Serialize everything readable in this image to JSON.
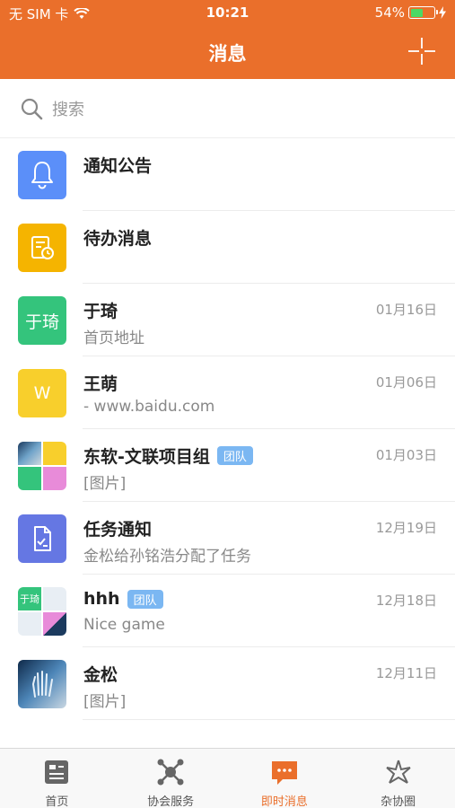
{
  "status": {
    "carrier": "无 SIM 卡",
    "time": "10:21",
    "battery": "54%",
    "battery_level": 0.54
  },
  "header": {
    "title": "消息"
  },
  "search": {
    "placeholder": "搜索"
  },
  "messages": [
    {
      "name": "通知公告",
      "preview": "",
      "date": "",
      "tag": ""
    },
    {
      "name": "待办消息",
      "preview": "",
      "date": "",
      "tag": ""
    },
    {
      "name": "于琦",
      "preview": "首页地址",
      "date": "01月16日",
      "tag": "",
      "avatar_text": "于琦"
    },
    {
      "name": "王萌",
      "preview": "- www.baidu.com",
      "date": "01月06日",
      "tag": "",
      "avatar_text": "W"
    },
    {
      "name": "东软-文联项目组",
      "preview": "[图片]",
      "date": "01月03日",
      "tag": "团队"
    },
    {
      "name": "任务通知",
      "preview": "金松给孙铭浩分配了任务",
      "date": "12月19日",
      "tag": ""
    },
    {
      "name": "hhh",
      "preview": "Nice game",
      "date": "12月18日",
      "tag": "团队",
      "avatar_text": "于琦"
    },
    {
      "name": "金松",
      "preview": "[图片]",
      "date": "12月11日",
      "tag": ""
    }
  ],
  "tabs": [
    {
      "label": "首页",
      "icon": "home-icon"
    },
    {
      "label": "协会服务",
      "icon": "network-icon"
    },
    {
      "label": "即时消息",
      "icon": "chat-icon",
      "active": true
    },
    {
      "label": "杂协圈",
      "icon": "shutter-icon"
    }
  ],
  "colors": {
    "accent": "#ea6f2b",
    "bell_bg": "#5b8ff9",
    "todo_bg": "#f5b400",
    "green_bg": "#34c47c",
    "yellow_bg": "#f8cf2c",
    "task_bg": "#6577e3",
    "tag_bg": "#7bb7f2"
  }
}
